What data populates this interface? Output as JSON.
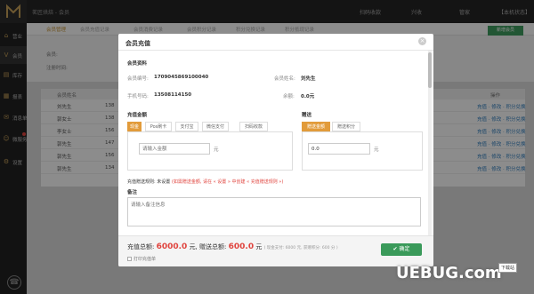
{
  "topbar": {
    "shop_name": "茗匠烘焙 - 会员",
    "items": [
      "扫码收款",
      "兴收",
      "管家",
      "【本机状态】"
    ]
  },
  "sidebar": {
    "items": [
      {
        "icon": "home-icon",
        "label": "营业"
      },
      {
        "icon": "vip-icon",
        "label": "会员"
      },
      {
        "icon": "stock-icon",
        "label": "库存"
      },
      {
        "icon": "report-icon",
        "label": "报表"
      },
      {
        "icon": "message-icon",
        "label": "消息单"
      },
      {
        "icon": "wechat-icon",
        "label": "微服务"
      },
      {
        "icon": "gear-icon",
        "label": "设置"
      }
    ],
    "bottom_icon": "phone-icon"
  },
  "tabs": [
    "会员管理",
    "会员充值记录",
    "会员消费记录",
    "会员积分记录",
    "积分兑换记录",
    "积分抵现记录"
  ],
  "new_member_button": "新增会员",
  "filter": {
    "label1": "会员:",
    "label2": "注册时间:"
  },
  "grid": {
    "header": [
      "会员姓名",
      "操作"
    ],
    "rows": [
      {
        "name": "刘先生",
        "phone": "138"
      },
      {
        "name": "郭女士",
        "phone": "138"
      },
      {
        "name": "李女士",
        "phone": "156"
      },
      {
        "name": "郭先生",
        "phone": "147"
      },
      {
        "name": "郭先生",
        "phone": "156"
      },
      {
        "name": "郭先生",
        "phone": "134"
      }
    ],
    "ops": "充值 · 修改 · 积分兑换"
  },
  "modal": {
    "title": "会员充值",
    "close_icon": "close-icon",
    "member_section": "会员资料",
    "card_label": "会员编号:",
    "card_value": "1709045869100040",
    "name_label": "会员姓名:",
    "name_value": "刘先生",
    "phone_label": "手机号码:",
    "phone_value": "13508114150",
    "balance_label": "余额:",
    "balance_value": "0.0元",
    "recharge_section": "充值金额",
    "pay_types": [
      "现金",
      "Pos刷卡",
      "支付宝",
      "微信支付",
      "扫码收款"
    ],
    "active_pay": 0,
    "amount_placeholder": "请输入金额",
    "amount_unit": "元",
    "gift_section": "赠送",
    "gift_types": [
      "赠送金额",
      "赠送积分"
    ],
    "active_gift": 0,
    "gift_value": "0.0",
    "gift_unit": "元",
    "rule_label": "充值赠送规则: 未设置",
    "rule_hint": "(如需赠送金额, 请在 « 设置 » 中创建 « 充值赠送规则 »)",
    "note_section": "备注",
    "note_placeholder": "请输入备注信息",
    "total_label": "充值总额:",
    "total_value": "6000.0",
    "total_unit": "元,",
    "gift_total_label": "赠送总额:",
    "gift_total_value": "600.0",
    "gift_total_unit": "元",
    "breakdown": "( 现金支付: 6000 元, 获赠积分: 600 分 )",
    "print_label": "打印充值单",
    "confirm_label": "确定"
  },
  "watermark": {
    "brand": "UEBUG.com",
    "badge": "下载站"
  },
  "colors": {
    "accent": "#e29b3a",
    "confirm": "#3a9a5a",
    "danger": "#e0443e",
    "sidebar": "#222222"
  }
}
